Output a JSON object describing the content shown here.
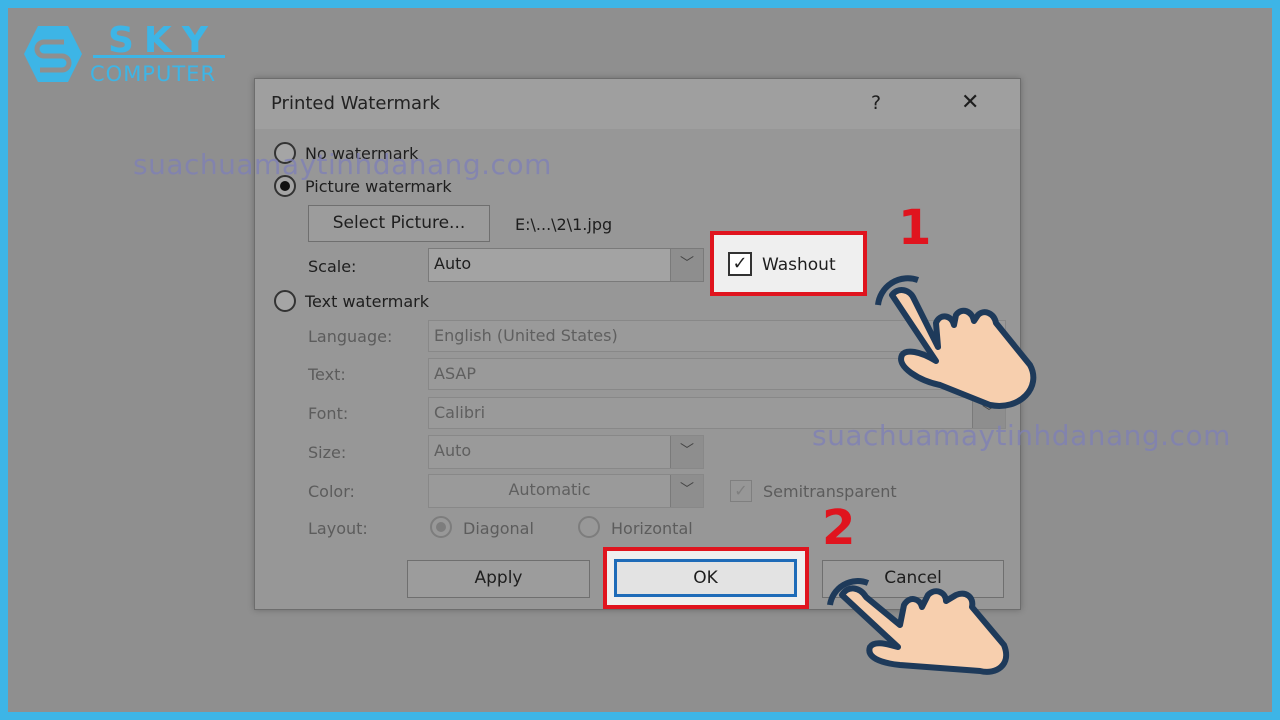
{
  "brand": {
    "line1": "SKY",
    "line2": "COMPUTER",
    "color": "#3db5e6"
  },
  "watermark_text": "suachuamaytinhdanang.com",
  "dialog": {
    "title": "Printed Watermark",
    "help": "?",
    "close": "✕",
    "no_watermark": {
      "label": "No watermark",
      "selected": false
    },
    "picture_watermark": {
      "label": "Picture watermark",
      "selected": true
    },
    "select_picture": "Select Picture...",
    "picture_path": "E:\\...\\2\\1.jpg",
    "scale_label": "Scale:",
    "scale_value": "Auto",
    "washout": {
      "label": "Washout",
      "checked": true
    },
    "text_watermark": {
      "label": "Text watermark",
      "selected": false
    },
    "language_label": "Language:",
    "language_value": "English (United States)",
    "text_label": "Text:",
    "text_value": "ASAP",
    "font_label": "Font:",
    "font_value": "Calibri",
    "size_label": "Size:",
    "size_value": "Auto",
    "color_label": "Color:",
    "color_value": "Automatic",
    "semitransparent": {
      "label": "Semitransparent",
      "checked": true
    },
    "layout_label": "Layout:",
    "layout_options": [
      "Diagonal",
      "Horizontal"
    ],
    "layout_selected": "Diagonal",
    "apply": "Apply",
    "ok": "OK",
    "cancel": "Cancel"
  },
  "annotations": {
    "step1": "1",
    "step2": "2",
    "highlight_color": "#e0141e"
  }
}
